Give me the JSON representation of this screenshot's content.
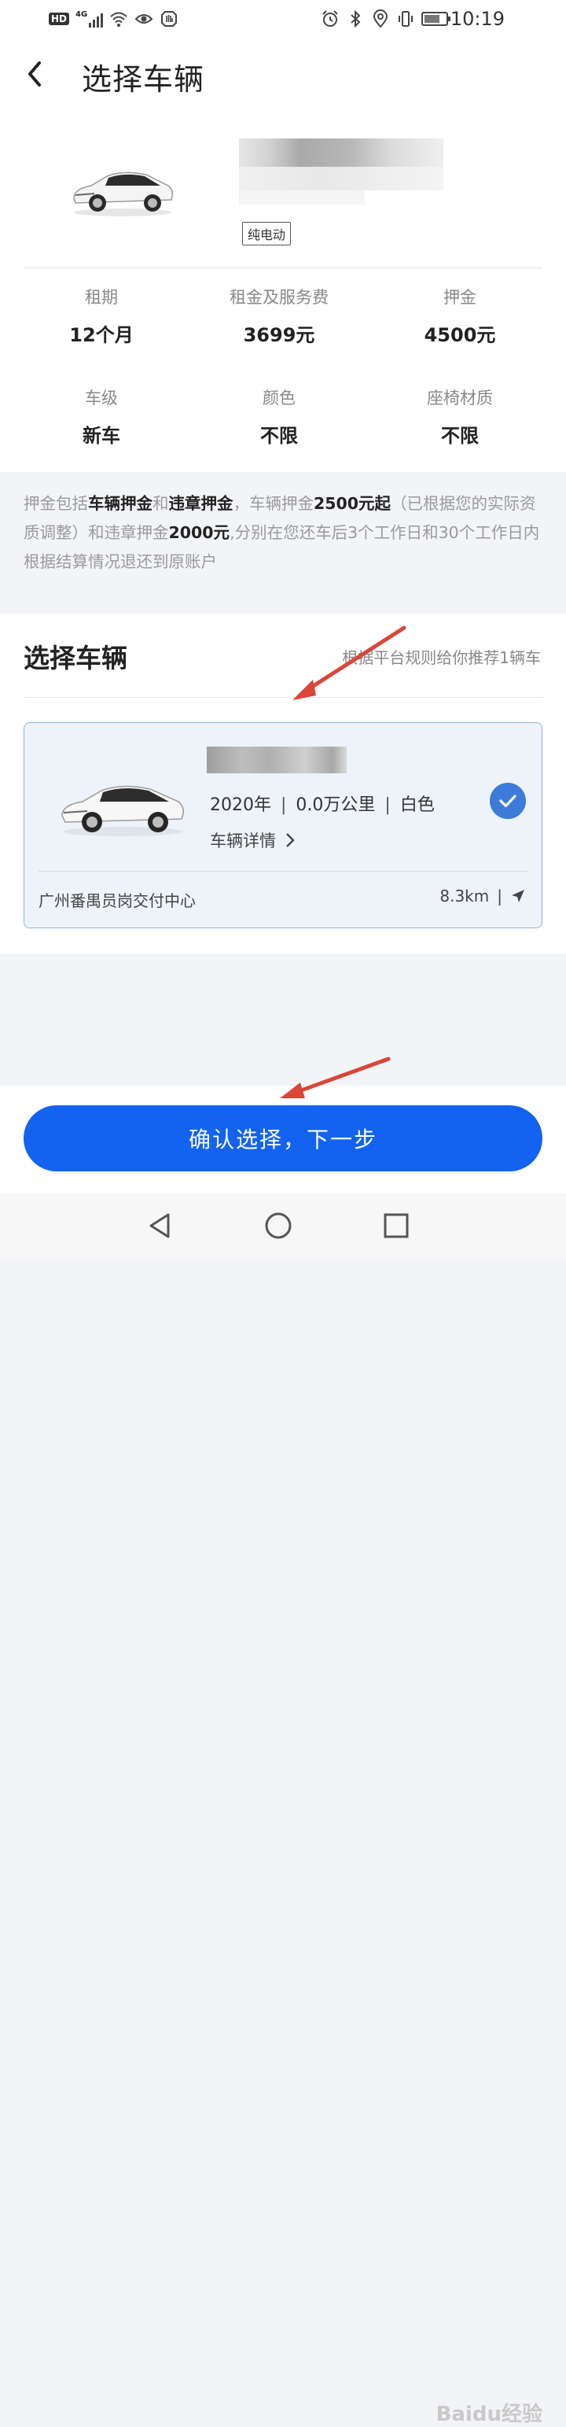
{
  "status_bar": {
    "hd": "HD",
    "network": "4G",
    "time": "10:19",
    "icons": [
      "signal-icon",
      "wifi-icon",
      "eye-icon",
      "hand-icon",
      "alarm-icon",
      "bluetooth-icon",
      "location-icon",
      "vibrate-icon",
      "battery-icon"
    ]
  },
  "header": {
    "title": "选择车辆",
    "back_icon": "chevron-left-icon"
  },
  "vehicle": {
    "tag": "纯电动",
    "specs": [
      {
        "label": "租期",
        "value": "12个月"
      },
      {
        "label": "租金及服务费",
        "value": "3699元"
      },
      {
        "label": "押金",
        "value": "4500元"
      },
      {
        "label": "车级",
        "value": "新车"
      },
      {
        "label": "颜色",
        "value": "不限"
      },
      {
        "label": "座椅材质",
        "value": "不限"
      }
    ]
  },
  "deposit_note": {
    "t1": "押金包括",
    "b1": "车辆押金",
    "t2": "和",
    "b2": "违章押金",
    "t3": "，车辆押金",
    "b3": "2500元起",
    "t4": "（已根据您的实际资质调整）和违章押金",
    "b4": "2000元",
    "t5": ",分别在您还车后3个工作日和30个工作日内根据结算情况退还到原账户"
  },
  "select_section": {
    "title": "选择车辆",
    "hint": "根据平台规则给你推荐1辆车",
    "card": {
      "year": "2020年",
      "mileage": "0.0万公里",
      "color": "白色",
      "separator": "|",
      "detail_link": "车辆详情",
      "location": "广州番禺员岗交付中心",
      "distance": "8.3km",
      "selected": true
    }
  },
  "confirm_button": "确认选择，下一步",
  "watermark": "Baidu经验",
  "colors": {
    "primary": "#1363f0",
    "check": "#3d7bd9",
    "card_bg": "#eef3fa",
    "arrow": "#d9463a"
  }
}
